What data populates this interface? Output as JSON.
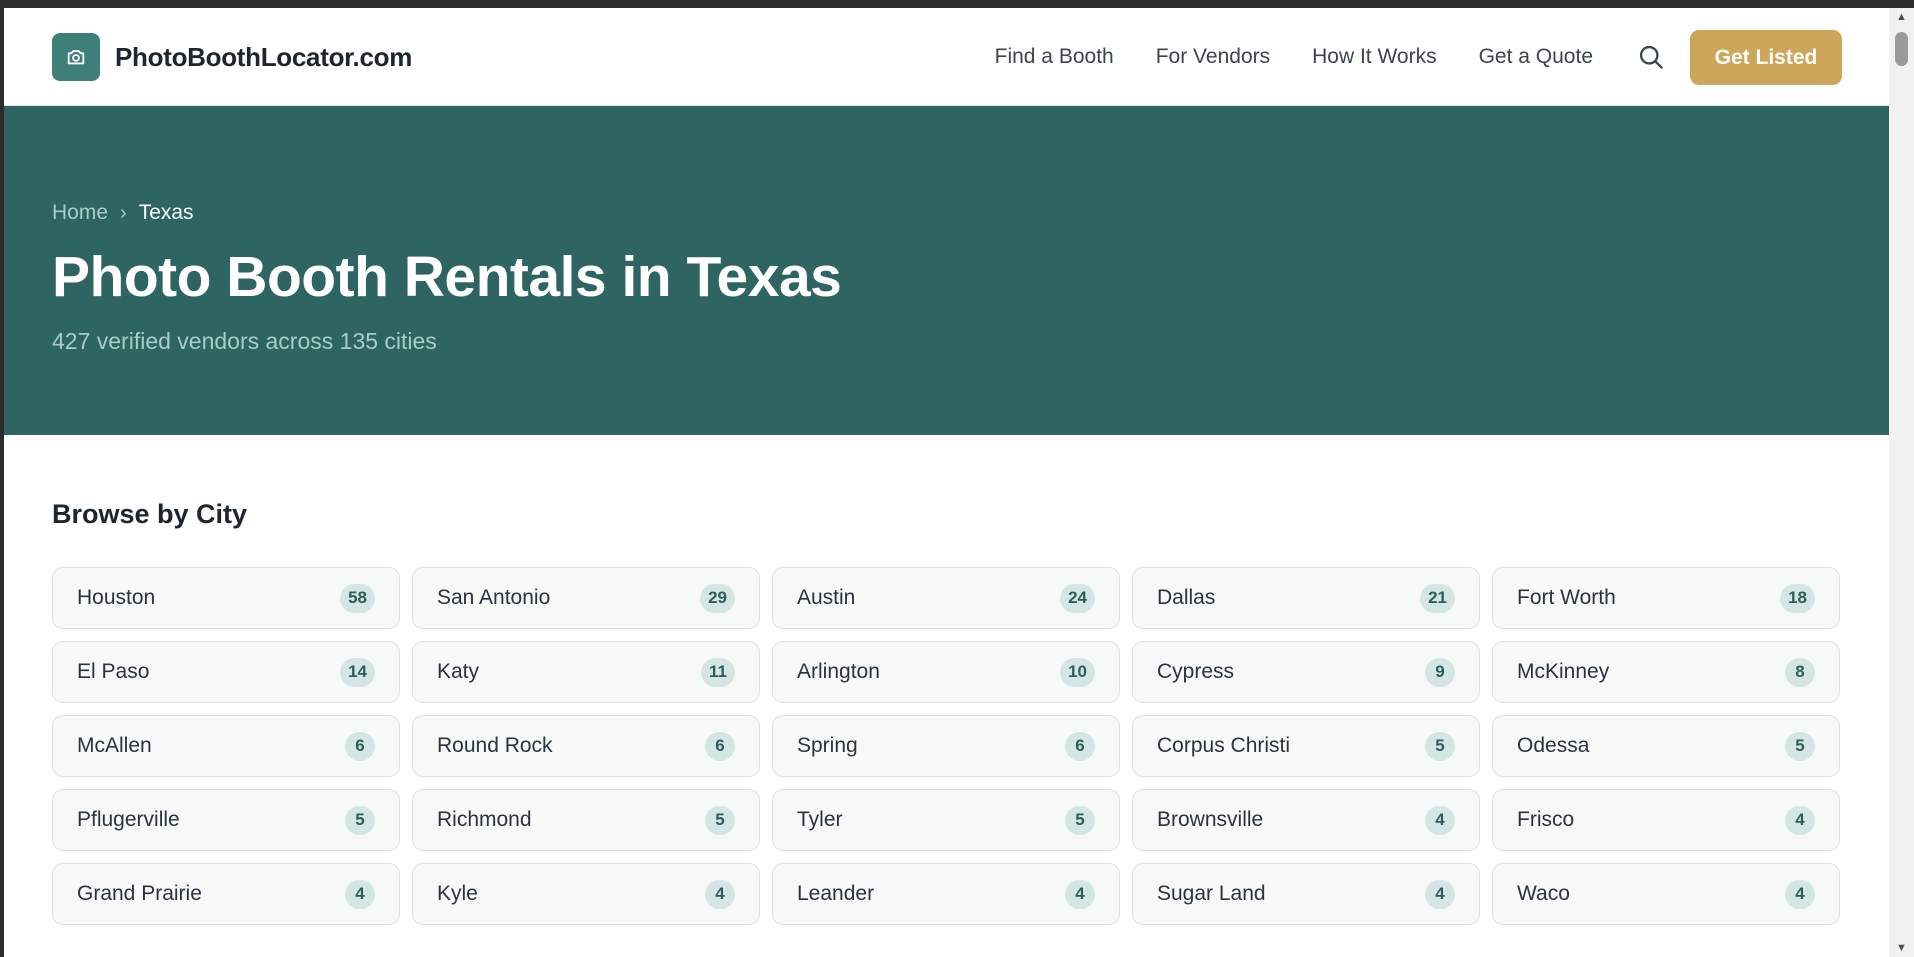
{
  "header": {
    "logo_text": "PhotoBoothLocator.com",
    "logo_icon": "camera-icon",
    "nav": [
      "Find a Booth",
      "For Vendors",
      "How It Works",
      "Get a Quote"
    ],
    "search_icon": "search-icon",
    "cta_label": "Get Listed"
  },
  "hero": {
    "breadcrumb_home": "Home",
    "breadcrumb_sep": "›",
    "breadcrumb_current": "Texas",
    "title": "Photo Booth Rentals in Texas",
    "subtitle": "427 verified vendors across 135 cities"
  },
  "browse": {
    "title": "Browse by City",
    "cities": [
      {
        "name": "Houston",
        "count": "58"
      },
      {
        "name": "San Antonio",
        "count": "29"
      },
      {
        "name": "Austin",
        "count": "24"
      },
      {
        "name": "Dallas",
        "count": "21"
      },
      {
        "name": "Fort Worth",
        "count": "18"
      },
      {
        "name": "El Paso",
        "count": "14"
      },
      {
        "name": "Katy",
        "count": "11"
      },
      {
        "name": "Arlington",
        "count": "10"
      },
      {
        "name": "Cypress",
        "count": "9"
      },
      {
        "name": "McKinney",
        "count": "8"
      },
      {
        "name": "McAllen",
        "count": "6"
      },
      {
        "name": "Round Rock",
        "count": "6"
      },
      {
        "name": "Spring",
        "count": "6"
      },
      {
        "name": "Corpus Christi",
        "count": "5"
      },
      {
        "name": "Odessa",
        "count": "5"
      },
      {
        "name": "Pflugerville",
        "count": "5"
      },
      {
        "name": "Richmond",
        "count": "5"
      },
      {
        "name": "Tyler",
        "count": "5"
      },
      {
        "name": "Brownsville",
        "count": "4"
      },
      {
        "name": "Frisco",
        "count": "4"
      },
      {
        "name": "Grand Prairie",
        "count": "4"
      },
      {
        "name": "Kyle",
        "count": "4"
      },
      {
        "name": "Leander",
        "count": "4"
      },
      {
        "name": "Sugar Land",
        "count": "4"
      },
      {
        "name": "Waco",
        "count": "4"
      }
    ]
  },
  "colors": {
    "brand_teal": "#2e6461",
    "accent_gold": "#cda65a"
  }
}
